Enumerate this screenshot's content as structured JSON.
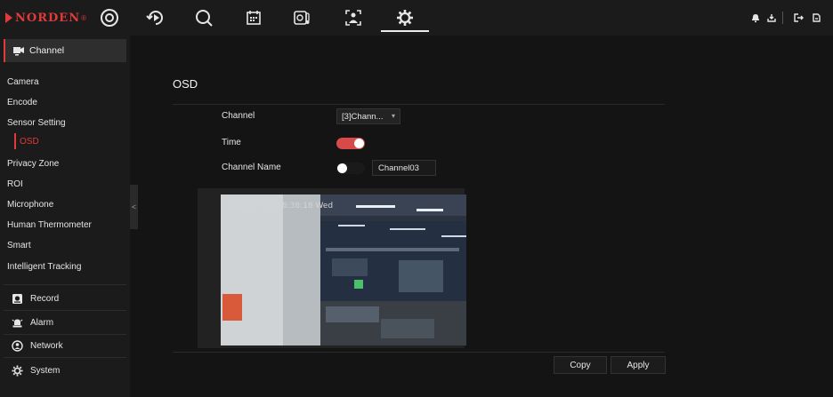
{
  "brand": {
    "name": "NORDEN",
    "mark": "®"
  },
  "topnav": [
    {
      "id": "live",
      "icon": "live-view-icon"
    },
    {
      "id": "playback",
      "icon": "playback-icon"
    },
    {
      "id": "search",
      "icon": "search-icon"
    },
    {
      "id": "calendar",
      "icon": "calendar-icon"
    },
    {
      "id": "thermometer",
      "icon": "thermometer-icon"
    },
    {
      "id": "face",
      "icon": "face-recognition-icon"
    },
    {
      "id": "settings",
      "icon": "gear-icon",
      "active": true
    }
  ],
  "topright": [
    "bell-icon",
    "download-icon",
    "logout-icon",
    "exit-icon"
  ],
  "sidebar": {
    "channel_label": "Channel",
    "items": [
      {
        "label": "Camera"
      },
      {
        "label": "Encode"
      },
      {
        "label": "Sensor Setting"
      },
      {
        "label": "OSD",
        "active": true
      },
      {
        "label": "Privacy Zone"
      },
      {
        "label": "ROI"
      },
      {
        "label": "Microphone"
      },
      {
        "label": "Human Thermometer"
      },
      {
        "label": "Smart"
      },
      {
        "label": "Intelligent Tracking"
      }
    ],
    "menu": [
      {
        "label": "Record",
        "icon": "record-icon"
      },
      {
        "label": "Alarm",
        "icon": "alarm-icon"
      },
      {
        "label": "Network",
        "icon": "network-icon"
      },
      {
        "label": "System",
        "icon": "system-icon"
      }
    ],
    "collapse": "<"
  },
  "osd": {
    "title": "OSD",
    "channel_label": "Channel",
    "channel_value": "[3]Chann...",
    "time_label": "Time",
    "time_enabled": true,
    "channel_name_label": "Channel Name",
    "channel_name_enabled": false,
    "channel_name_value": "Channel03",
    "preview_timestamp": "2022-07-13 16:38:18 Wed"
  },
  "actions": {
    "copy": "Copy",
    "apply": "Apply"
  },
  "colors": {
    "accent": "#e03a3a",
    "toggle_on": "#d84a4a",
    "background": "#141414"
  }
}
